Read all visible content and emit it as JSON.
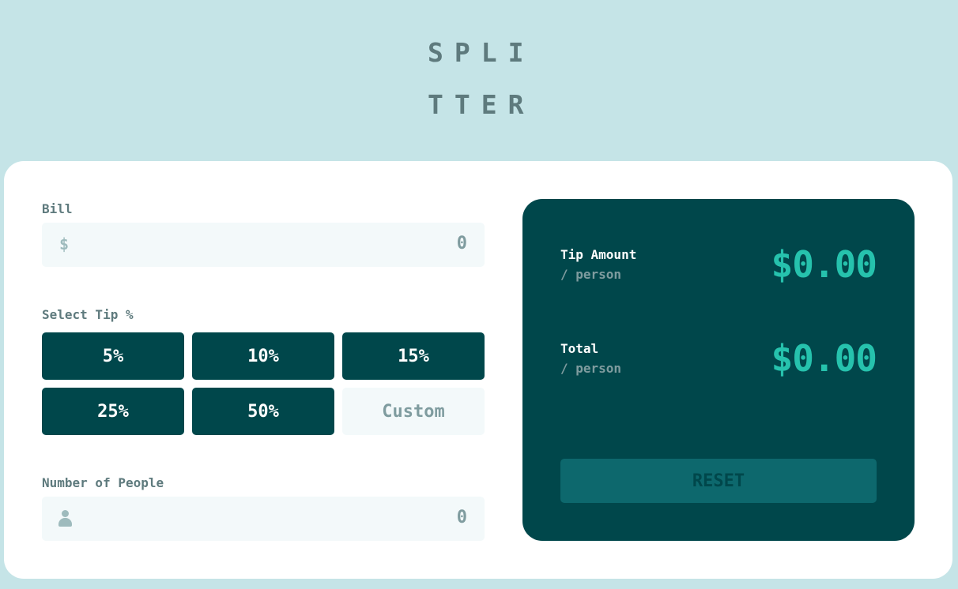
{
  "logo": {
    "text": "SPLITTER"
  },
  "bill": {
    "label": "Bill",
    "currency_symbol": "$",
    "value": "0"
  },
  "tip": {
    "label": "Select Tip %",
    "options": [
      "5%",
      "10%",
      "15%",
      "25%",
      "50%"
    ],
    "custom_placeholder": "Custom"
  },
  "people": {
    "label": "Number of People",
    "value": "0"
  },
  "results": {
    "tip_amount_label": "Tip Amount",
    "tip_amount_sub": "/ person",
    "tip_amount_value": "$0.00",
    "total_label": "Total",
    "total_sub": "/ person",
    "total_value": "$0.00",
    "reset_label": "RESET"
  },
  "colors": {
    "background": "#c5e4e7",
    "card": "#ffffff",
    "dark_cyan": "#00474b",
    "strong_cyan": "#26c2ad",
    "input_bg": "#f3f9fa",
    "grey_text": "#5e7a7d",
    "reset_disabled": "#0d686d"
  }
}
